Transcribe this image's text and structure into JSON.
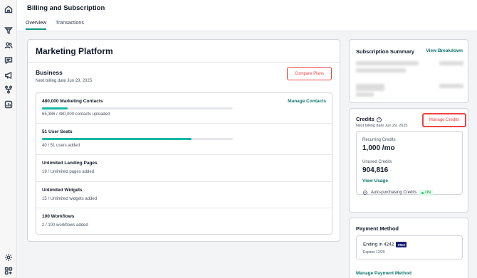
{
  "sidebar": {
    "icons": [
      "home-icon",
      "funnel-icon",
      "users-icon",
      "chat-icon",
      "megaphone-icon",
      "workflow-icon",
      "chart-icon",
      "settings-icon",
      "apps-icon"
    ]
  },
  "header": {
    "title": "Billing and Subscription",
    "tabs": [
      {
        "label": "Overview",
        "active": true
      },
      {
        "label": "Transactions",
        "active": false
      }
    ]
  },
  "plan": {
    "product": "Marketing Platform",
    "name": "Business",
    "next_billing": "Next billing date Jun 29, 2025",
    "compare_label": "Compare Plans",
    "features": [
      {
        "title": "480,000 Marketing Contacts",
        "sub": "65,386 / 480,000 contacts uploaded",
        "progress": 0.136,
        "link": "Manage Contacts"
      },
      {
        "title": "51 User Seats",
        "sub": "40 / 51 users added",
        "progress": 0.784
      },
      {
        "title": "Unlimited Landing Pages",
        "sub": "19 / Unlimited pages added"
      },
      {
        "title": "Unlimited Widgets",
        "sub": "15 / Unlimited widgets added"
      },
      {
        "title": "100 Workflows",
        "sub": "2 / 100 workflows added"
      }
    ]
  },
  "subscription_summary": {
    "title": "Subscription Summary",
    "link": "View Breakdown"
  },
  "credits": {
    "title": "Credits",
    "info_icon": "i",
    "next_billing": "Next billing date Jun 29, 2025",
    "manage_label": "Manage Credits",
    "recurring_label": "Recurring Credits",
    "recurring_value": "1,000 /mo",
    "unused_label": "Unused Credits",
    "unused_value": "904,816",
    "view_usage": "View Usage",
    "auto_label": "Auto-purchasing Credits",
    "auto_status": "ON"
  },
  "payment": {
    "title": "Payment Method",
    "ending": "Ending in 4242",
    "brand": "VISA",
    "expires": "Expires 12/29",
    "manage_label": "Manage Payment Method"
  },
  "colors": {
    "accent": "#0f766e",
    "progress": "#14b8a6",
    "danger": "#ef4444"
  }
}
